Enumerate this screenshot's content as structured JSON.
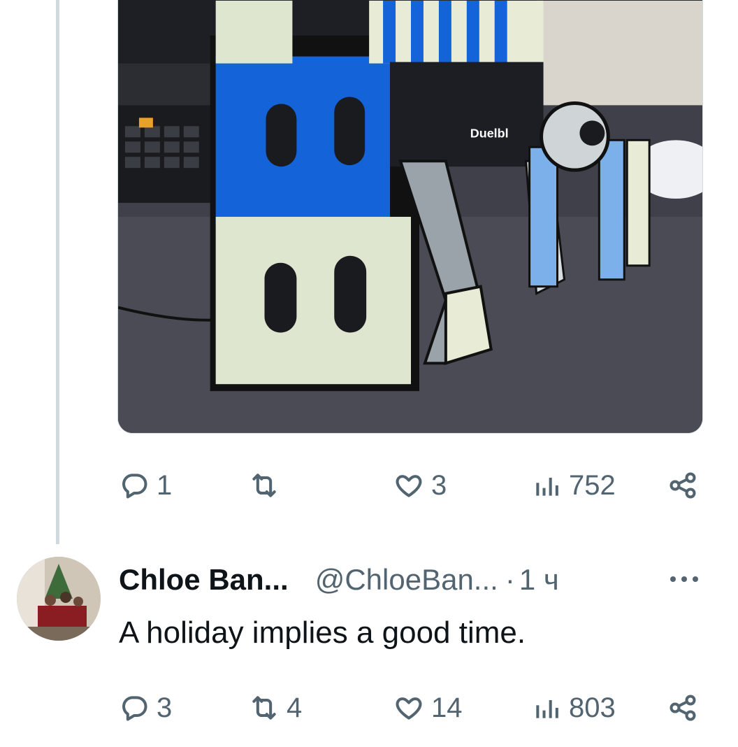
{
  "tweet1": {
    "media_alt": "3D printed letter B display with footballer figure",
    "jersey_brand_text": "Duelbl",
    "actions": {
      "replies": "1",
      "retweets": "",
      "likes": "3",
      "views": "752"
    }
  },
  "tweet2": {
    "author_name": "Chloe Ban...",
    "author_handle": "@ChloeBan...",
    "separator": "·",
    "timestamp": "1 ч",
    "text": "A holiday implies a good time.",
    "actions": {
      "replies": "3",
      "retweets": "4",
      "likes": "14",
      "views": "803"
    }
  },
  "icons": [
    "reply-icon",
    "retweet-icon",
    "like-icon",
    "views-icon",
    "share-icon",
    "more-icon"
  ],
  "colors": {
    "secondary_text": "#536471",
    "primary_text": "#0f1419",
    "thread_line": "#cfd9de",
    "accent_blue": "#1463d8"
  }
}
